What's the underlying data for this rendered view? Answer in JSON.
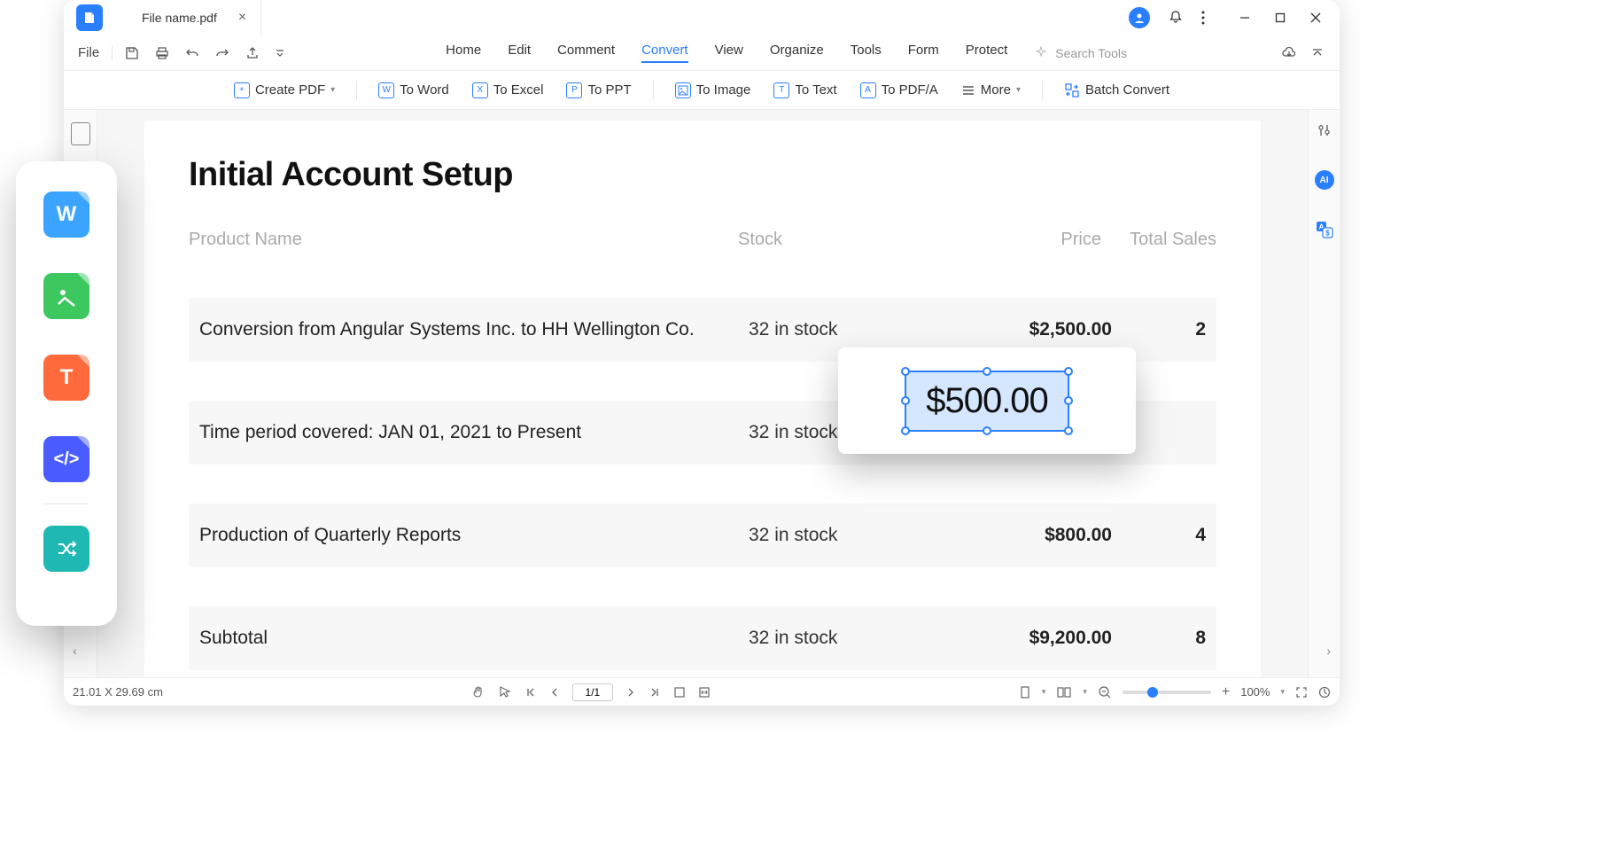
{
  "title_bar": {
    "file_name": "File name.pdf"
  },
  "menu": {
    "file": "File",
    "items": [
      "Home",
      "Edit",
      "Comment",
      "Convert",
      "View",
      "Organize",
      "Tools",
      "Form",
      "Protect"
    ],
    "active_index": 3,
    "search_placeholder": "Search Tools"
  },
  "ribbon": {
    "create": "Create PDF",
    "to_word": "To Word",
    "to_excel": "To Excel",
    "to_ppt": "To PPT",
    "to_image": "To Image",
    "to_text": "To Text",
    "to_pdfa": "To PDF/A",
    "more": "More",
    "batch": "Batch Convert"
  },
  "document": {
    "title": "Initial Account Setup",
    "headers": {
      "name": "Product Name",
      "stock": "Stock",
      "price": "Price",
      "sales": "Total Sales"
    },
    "rows": [
      {
        "name": "Conversion from Angular Systems Inc. to HH Wellington Co.",
        "stock": "32 in stock",
        "price": "$2,500.00",
        "sales": "2"
      },
      {
        "name": "Time period covered: JAN 01, 2021 to Present",
        "stock": "32 in stock",
        "price": "",
        "sales": ""
      },
      {
        "name": "Production of Quarterly Reports",
        "stock": "32 in stock",
        "price": "$800.00",
        "sales": "4"
      },
      {
        "name": "Subtotal",
        "stock": "32 in stock",
        "price": "$9,200.00",
        "sales": "8"
      }
    ],
    "edit_value": "$500.00"
  },
  "status": {
    "dimensions": "21.01 X 29.69 cm",
    "page": "1/1",
    "zoom": "100%"
  }
}
